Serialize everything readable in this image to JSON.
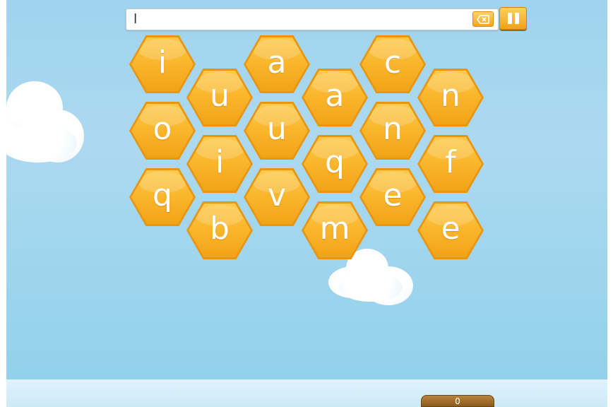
{
  "word_input": {
    "value": "l"
  },
  "tiles": [
    {
      "letter": "i"
    },
    {
      "letter": "o"
    },
    {
      "letter": "q"
    },
    {
      "letter": "u"
    },
    {
      "letter": "i"
    },
    {
      "letter": "b"
    },
    {
      "letter": "a"
    },
    {
      "letter": "u"
    },
    {
      "letter": "v"
    },
    {
      "letter": "a"
    },
    {
      "letter": "q"
    },
    {
      "letter": "m"
    },
    {
      "letter": "c"
    },
    {
      "letter": "n"
    },
    {
      "letter": "e"
    },
    {
      "letter": "n"
    },
    {
      "letter": "f"
    },
    {
      "letter": "e"
    }
  ],
  "score": {
    "value": "0"
  },
  "icons": {
    "backspace": "backspace-icon",
    "pause": "pause-icon"
  },
  "colors": {
    "tile_fill": "#f9b52b",
    "tile_edge": "#e8950f",
    "sky": "#a9d8ef"
  }
}
